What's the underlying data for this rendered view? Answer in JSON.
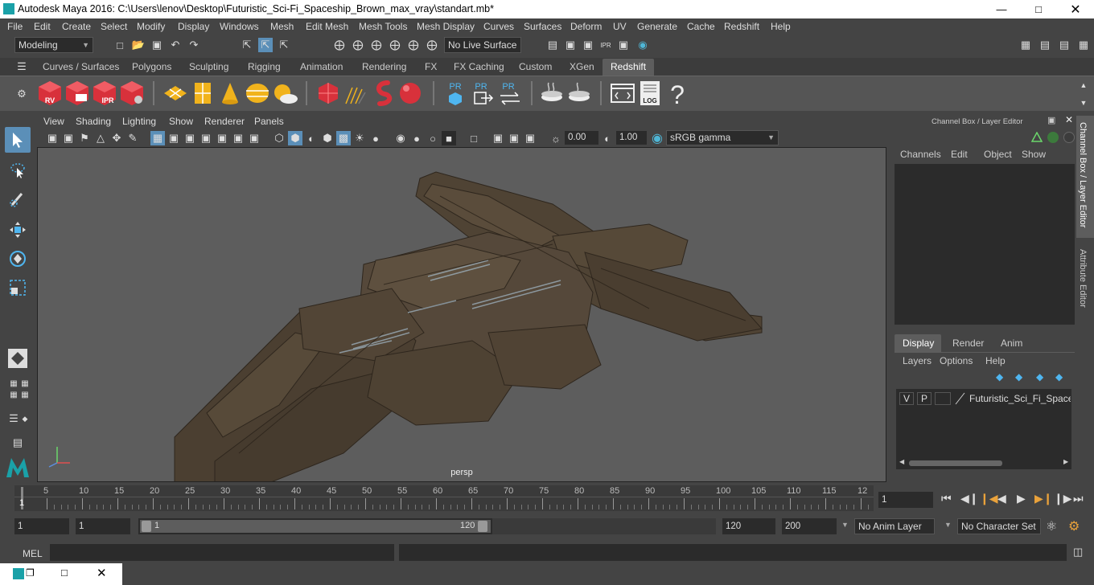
{
  "window": {
    "title": "Autodesk Maya 2016: C:\\Users\\lenov\\Desktop\\Futuristic_Sci-Fi_Spaceship_Brown_max_vray\\standart.mb*"
  },
  "menubar": [
    "File",
    "Edit",
    "Create",
    "Select",
    "Modify",
    "Display",
    "Windows",
    "Mesh",
    "Edit Mesh",
    "Mesh Tools",
    "Mesh Display",
    "Curves",
    "Surfaces",
    "Deform",
    "UV",
    "Generate",
    "Cache",
    "Redshift",
    "Help"
  ],
  "status": {
    "mode": "Modeling",
    "live_surface": "No Live Surface"
  },
  "shelf_tabs": [
    "Curves / Surfaces",
    "Polygons",
    "Sculpting",
    "Rigging",
    "Animation",
    "Rendering",
    "FX",
    "FX Caching",
    "Custom",
    "XGen",
    "Redshift"
  ],
  "shelf": {
    "rv": "RV",
    "ipr": "IPR",
    "pr": "PR",
    "log": "LOG",
    "help": "?"
  },
  "panel_menu": [
    "View",
    "Shading",
    "Lighting",
    "Show",
    "Renderer",
    "Panels"
  ],
  "panel_tools": {
    "exposure": "0.00",
    "gamma": "1.00",
    "color_space": "sRGB gamma"
  },
  "viewport": {
    "camera": "persp"
  },
  "channel_box": {
    "title": "Channel Box / Layer Editor",
    "menu": [
      "Channels",
      "Edit",
      "Object",
      "Show"
    ]
  },
  "layer_editor": {
    "tabs": [
      "Display",
      "Render",
      "Anim"
    ],
    "menu": [
      "Layers",
      "Options",
      "Help"
    ],
    "layer": {
      "v": "V",
      "p": "P",
      "name": "Futuristic_Sci_Fi_Spaceship"
    }
  },
  "side_tabs": [
    "Channel Box / Layer Editor",
    "Attribute Editor"
  ],
  "timeline": {
    "ticks": [
      "5",
      "10",
      "15",
      "20",
      "25",
      "30",
      "35",
      "40",
      "45",
      "50",
      "55",
      "60",
      "65",
      "70",
      "75",
      "80",
      "85",
      "90",
      "95",
      "100",
      "105",
      "110",
      "115",
      "12"
    ],
    "start_marker": "1",
    "current_frame": "1"
  },
  "range": {
    "start": "1",
    "playback_start": "1",
    "slider_start": "1",
    "slider_end": "120",
    "playback_end": "120",
    "end": "200",
    "anim_layer": "No Anim Layer",
    "character_set": "No Character Set"
  },
  "cmd": {
    "label": "MEL"
  },
  "colors": {
    "accent": "#1aa1a8",
    "viewport_bg": "#5d5d5d",
    "ui_bg": "#444444",
    "ship": "#4f4334"
  }
}
